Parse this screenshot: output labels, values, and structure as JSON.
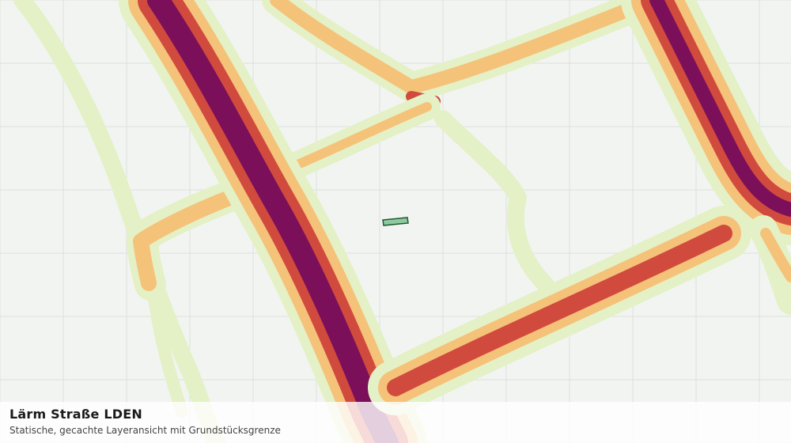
{
  "map": {
    "layer_name": "Lärm Straße LDEN",
    "description": "Statische, gecachte Layeransicht mit Grundstücksgrenze",
    "colors": {
      "background": "#f2f4f2",
      "grid": "#dcdfdc",
      "noise_level_1": "#e4f1c6",
      "noise_level_2": "#f5c27a",
      "noise_level_3": "#d14a3e",
      "noise_level_4": "#7b0f5a",
      "parcel_fill": "#8fc9a0",
      "parcel_border": "#1e5a32"
    }
  }
}
